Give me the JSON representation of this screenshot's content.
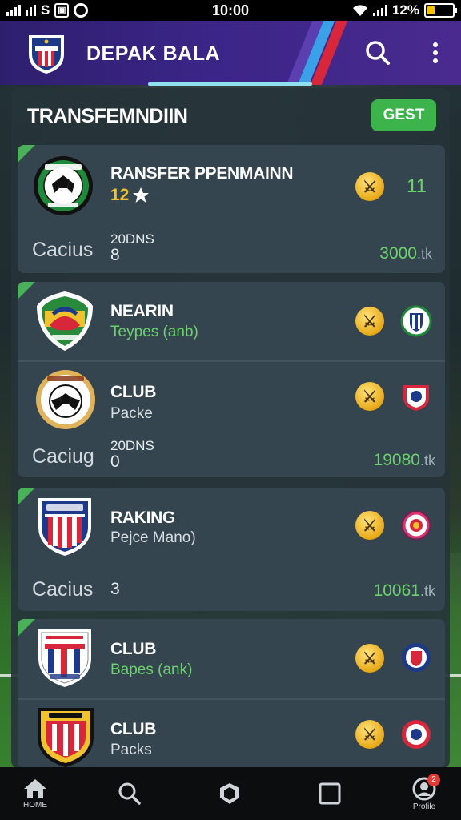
{
  "status_bar": {
    "carrier": "S",
    "time": "10:00",
    "battery": "12%"
  },
  "header": {
    "app_title": "DEPAK BALA",
    "search_icon": "search-icon",
    "menu_icon": "more-vert-icon"
  },
  "section": {
    "title": "TRANSFEMNDIIN",
    "action_label": "GEST"
  },
  "cards": [
    {
      "name": "RANSFER PPENMAINN",
      "rating": "12",
      "caption": "Cacius",
      "stat_label": "20DNS",
      "stat_value": "8",
      "price": "3000",
      "price_unit": ".tk",
      "right_value": "11"
    },
    {
      "name": "NEARIN",
      "subtitle": "Teypes (anb)"
    },
    {
      "name": "CLUB",
      "subtitle": "Packe",
      "caption": "Caciug",
      "stat_label": "20DNS",
      "stat_value": "0",
      "price": "19080",
      "price_unit": ".tk"
    },
    {
      "name": "RAKING",
      "subtitle": "Pejce Mano)",
      "caption": "Cacius",
      "stat_value": "3",
      "price": "10061",
      "price_unit": ".tk"
    },
    {
      "name": "CLUB",
      "subtitle": "Bapes (ank)"
    },
    {
      "name": "CLUB",
      "subtitle": "Packs"
    }
  ],
  "bottom_nav": {
    "home_label": "HOME",
    "profile_label": "Profile",
    "badge_count": "2"
  },
  "colors": {
    "header": "#3b2587",
    "accent_green": "#3cb44b",
    "price_green": "#6bd36b",
    "coin_gold": "#e8a917"
  }
}
